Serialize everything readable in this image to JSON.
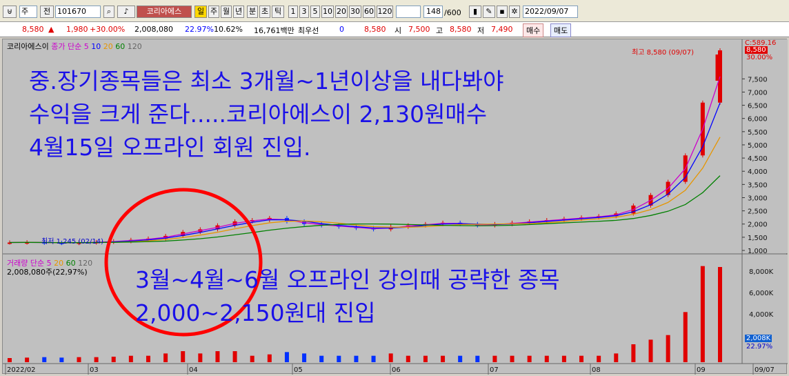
{
  "toolbar": {
    "mode": "주",
    "prev": "전",
    "code": "101670",
    "name": "코리아에스",
    "tag": "일",
    "periods": [
      "주",
      "월",
      "년",
      "분",
      "초",
      "틱"
    ],
    "nums": [
      "1",
      "3",
      "5",
      "10",
      "20",
      "30",
      "60",
      "120"
    ],
    "count": "148",
    "total": "/600",
    "date": "2022/09/07"
  },
  "price": {
    "last": "8,580",
    "chg": "1,980",
    "pct": "+30.00%",
    "vol": "2,008,080",
    "turn": "22.97%",
    "ratio": "10.62%",
    "amt": "16,761백만",
    "pref_label": "최우선",
    "pref_val": "0",
    "ask": "8,580",
    "open_label": "시",
    "open": "7,500",
    "high_label": "고",
    "high": "8,580",
    "low_label": "저",
    "low": "7,490",
    "buy": "매수",
    "sell": "매도"
  },
  "legend_top": {
    "name": "코리아에스이",
    "label": "종가 단순",
    "ma": [
      "5",
      "10",
      "20",
      "60",
      "120"
    ],
    "ma_colors": [
      "#ff00ff",
      "#0000ff",
      "#ffa500",
      "#008000",
      "#808080"
    ]
  },
  "legend_bot": {
    "label": "거래량",
    "sub": "단순",
    "ma": [
      "5",
      "20",
      "60",
      "120"
    ],
    "vol_text": "2,008,080주(22,97%)"
  },
  "overlay": {
    "line1": "중.장기종목들은 최소 3개월~1년이상을 내다봐야",
    "line2": "수익을 크게 준다.....코리아에스이 2,130원매수",
    "line3": "4월15일 오프라인 회원 진입.",
    "line4": "3월~4월~6월 오프라인 강의때 공략한 종목",
    "line5": "2,000~2,150원대 진입"
  },
  "marks": {
    "high": "최고 8,580 (09/07)",
    "low": "최저 1,245 (02/14)",
    "c_label": "C:589.16",
    "c_price": "8,580",
    "c_pct": "30.00%",
    "vol_tag": "2,008K",
    "vol_pct": "22.97%"
  },
  "chart_data": {
    "type": "candlestick",
    "price_ticks": [
      "7,500",
      "7,000",
      "6,500",
      "6,000",
      "5,500",
      "5,000",
      "4,500",
      "4,000",
      "3,500",
      "3,000",
      "2,500",
      "2,000",
      "1,500",
      "1,000"
    ],
    "vol_ticks": [
      "8,000K",
      "6,000K",
      "4,000K"
    ],
    "x_labels": [
      "2022/02",
      "03",
      "04",
      "05",
      "06",
      "07",
      "08",
      "09",
      "09/07"
    ],
    "ylim": [
      1000,
      8580
    ],
    "closes": [
      1300,
      1310,
      1290,
      1280,
      1300,
      1320,
      1350,
      1400,
      1450,
      1550,
      1700,
      1800,
      1950,
      2100,
      2150,
      2230,
      2100,
      2000,
      1950,
      1900,
      1850,
      1800,
      1900,
      1950,
      2000,
      2050,
      2000,
      1950,
      2000,
      2050,
      2100,
      2150,
      2200,
      2250,
      2300,
      2400,
      2700,
      3100,
      3600,
      4600,
      6600,
      8580
    ]
  }
}
